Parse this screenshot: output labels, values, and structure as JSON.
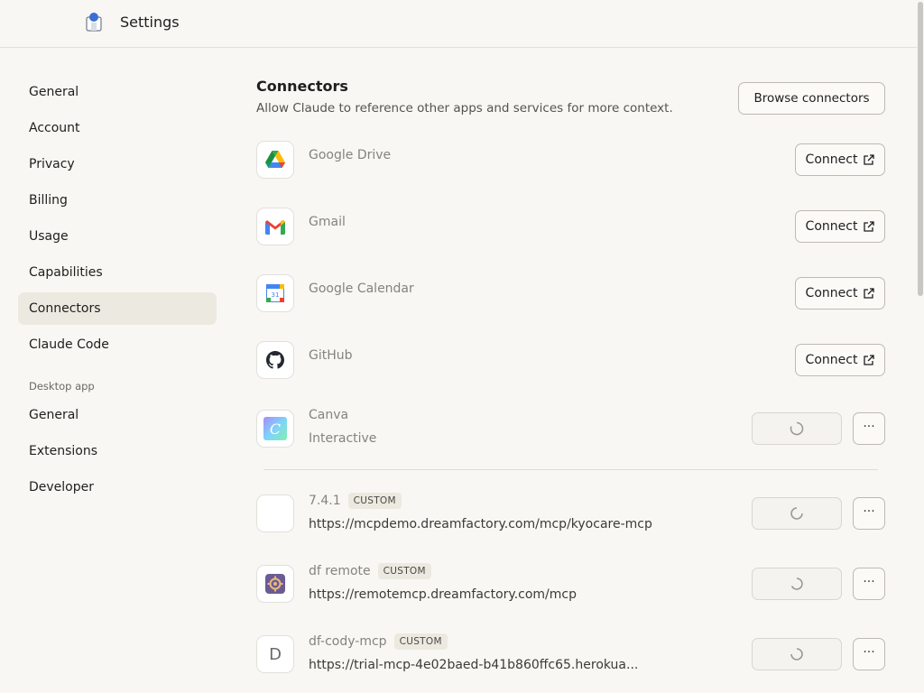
{
  "header": {
    "title": "Settings",
    "icon": "app-icon"
  },
  "sidebar": {
    "items": [
      {
        "label": "General"
      },
      {
        "label": "Account"
      },
      {
        "label": "Privacy"
      },
      {
        "label": "Billing"
      },
      {
        "label": "Usage"
      },
      {
        "label": "Capabilities"
      },
      {
        "label": "Connectors",
        "active": true
      },
      {
        "label": "Claude Code"
      }
    ],
    "desktop_section_label": "Desktop app",
    "desktop_items": [
      {
        "label": "General"
      },
      {
        "label": "Extensions"
      },
      {
        "label": "Developer"
      }
    ]
  },
  "main": {
    "title": "Connectors",
    "subtitle": "Allow Claude to reference other apps and services for more context.",
    "browse_label": "Browse connectors",
    "connectors": [
      {
        "name": "Google Drive",
        "icon": "google-drive-icon",
        "action": "Connect"
      },
      {
        "name": "Gmail",
        "icon": "gmail-icon",
        "action": "Connect"
      },
      {
        "name": "Google Calendar",
        "icon": "google-calendar-icon",
        "action": "Connect"
      },
      {
        "name": "GitHub",
        "icon": "github-icon",
        "action": "Connect"
      },
      {
        "name": "Canva",
        "subtitle": "Interactive",
        "icon": "canva-icon",
        "state": "loading"
      }
    ],
    "custom_connectors": [
      {
        "name": "7.4.1",
        "badge": "CUSTOM",
        "url": "https://mcpdemo.dreamfactory.com/mcp/kyocare-mcp",
        "icon": "blank-icon",
        "state": "loading"
      },
      {
        "name": "df remote",
        "badge": "CUSTOM",
        "url": "https://remotemcp.dreamfactory.com/mcp",
        "icon": "gear-icon",
        "state": "loading"
      },
      {
        "name": "df-cody-mcp",
        "badge": "CUSTOM",
        "url": "https://trial-mcp-4e02baed-b41b860ffc65.herokua...",
        "icon": "letter-d-icon",
        "icon_letter": "D",
        "state": "loading"
      }
    ],
    "more_label": "···"
  }
}
